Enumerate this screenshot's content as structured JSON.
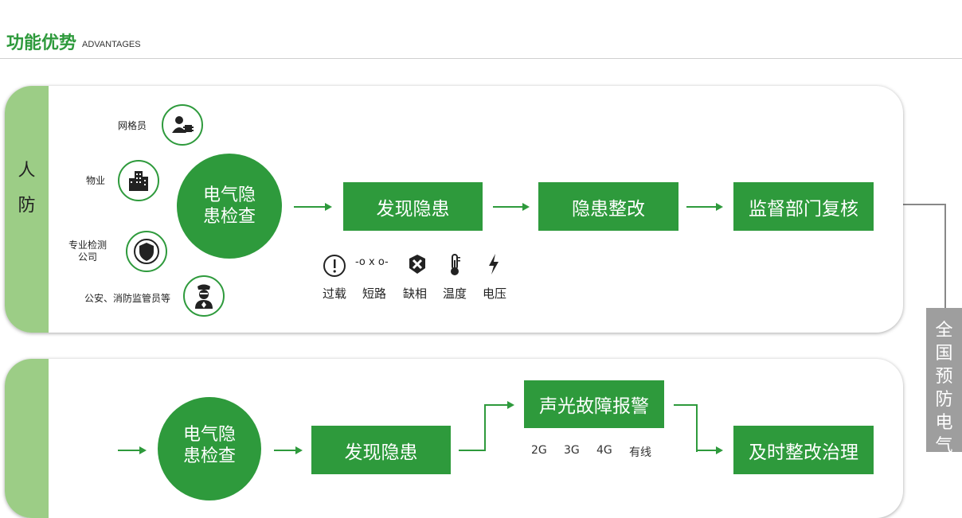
{
  "header": {
    "title": "功能优势",
    "subtitle": "ADVANTAGES"
  },
  "panel1": {
    "side_label": [
      "人",
      "防"
    ],
    "roles": [
      {
        "label": "网格员",
        "icon": "grid-worker-icon"
      },
      {
        "label": "物业",
        "icon": "building-icon"
      },
      {
        "label": "专业检测\n公司",
        "icon": "shield-icon"
      },
      {
        "label": "公安、消防监管员等",
        "icon": "police-icon"
      }
    ],
    "circle_text": "电气隐\n患检查",
    "steps": [
      "发现隐患",
      "隐患整改",
      "监督部门复核"
    ],
    "faults": [
      {
        "label": "过载",
        "glyph": "!"
      },
      {
        "label": "短路",
        "glyph": "-o x o-"
      },
      {
        "label": "缺相",
        "glyph": "✖"
      },
      {
        "label": "温度",
        "glyph": "🌡"
      },
      {
        "label": "电压",
        "glyph": "ϟ"
      }
    ]
  },
  "panel2": {
    "circle_text": "电气隐\n患检查",
    "step1": "发现隐患",
    "alarm": "声光故障报警",
    "networks": [
      "2G",
      "3G",
      "4G",
      "有线"
    ],
    "fix": "及时整改治理"
  },
  "right_bar": {
    "text": [
      "全",
      "国",
      "预",
      "防",
      "电",
      "气"
    ]
  },
  "colors": {
    "accent": "#2e9a3c",
    "side": "#9ccd86",
    "bar": "#9e9e9e"
  }
}
